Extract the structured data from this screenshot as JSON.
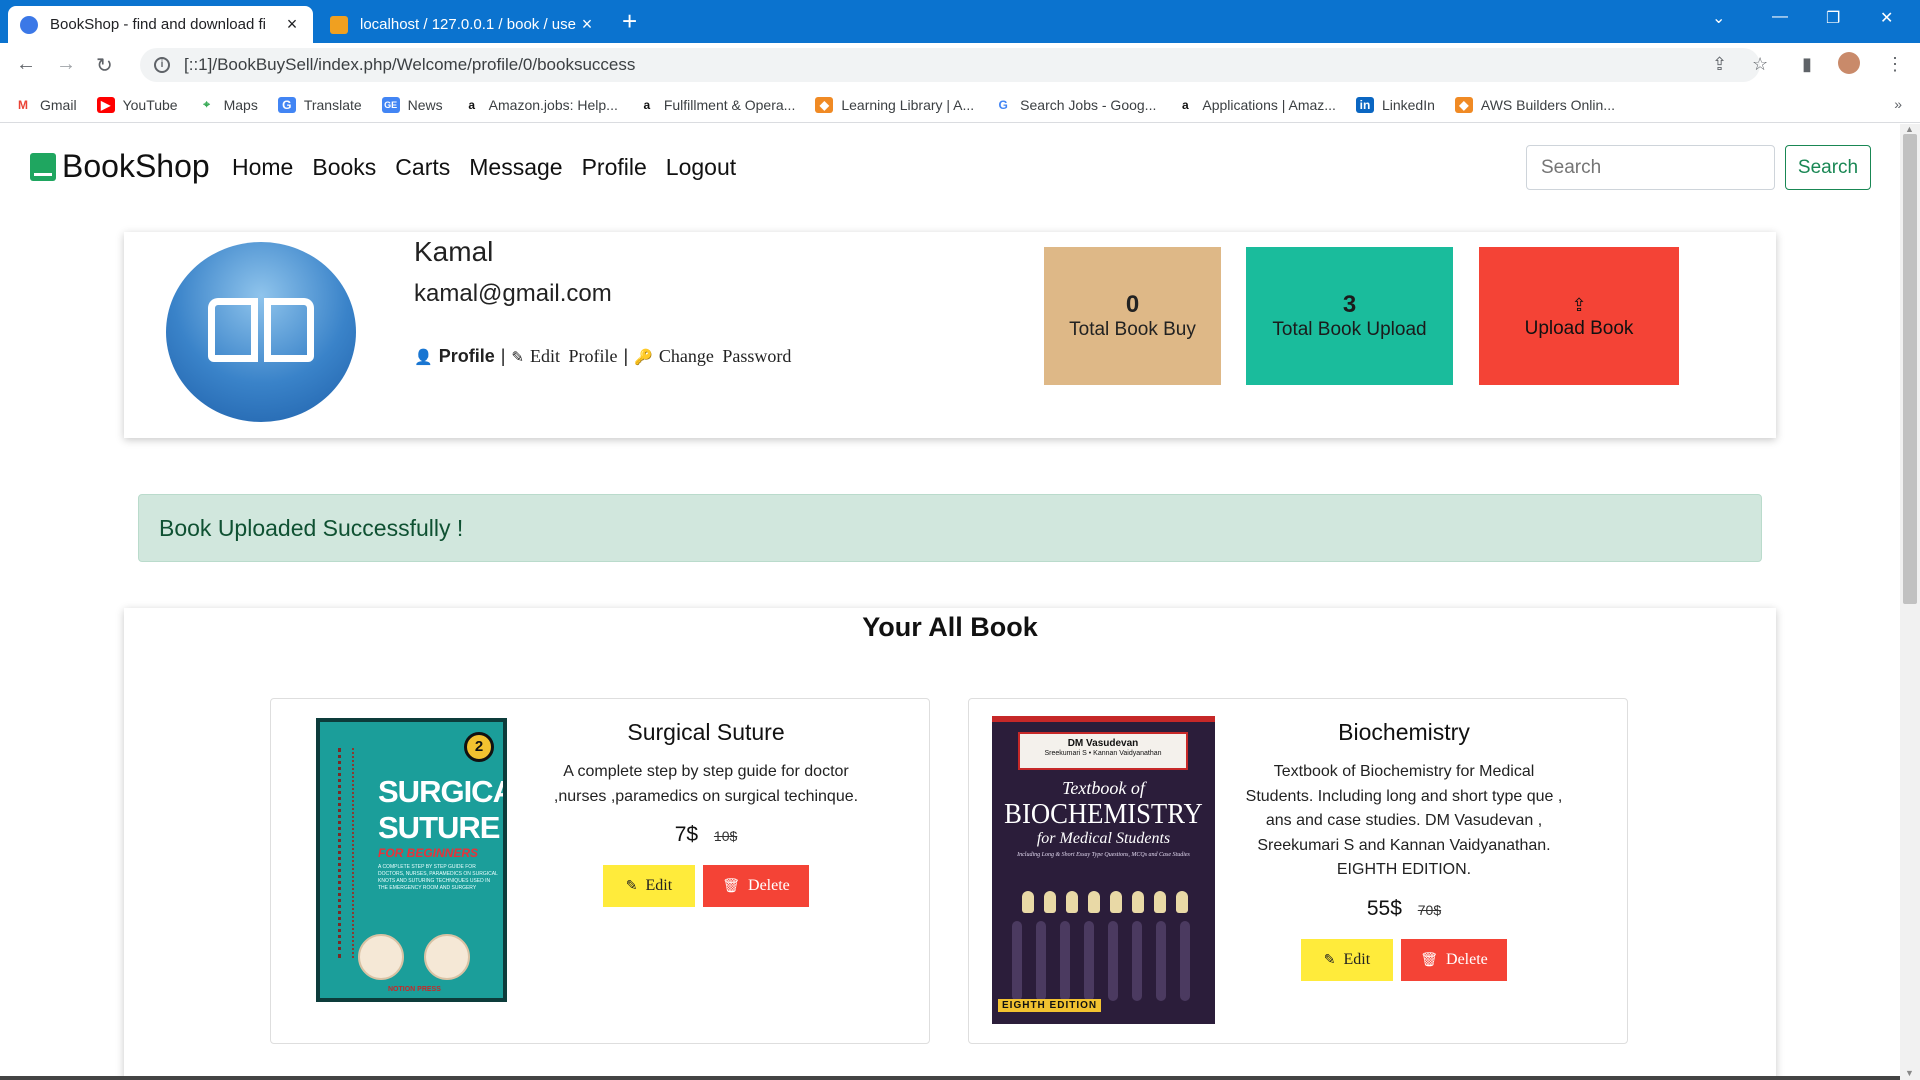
{
  "browser": {
    "tabs": [
      {
        "title": "BookShop - find and download fi",
        "active": true
      },
      {
        "title": "localhost / 127.0.0.1 / book / use",
        "active": false
      }
    ],
    "address": "[::1]/BookBuySell/index.php/Welcome/profile/0/booksuccess",
    "bookmarks": [
      {
        "label": "Gmail",
        "icon": "gmail-icon"
      },
      {
        "label": "YouTube",
        "icon": "youtube-icon"
      },
      {
        "label": "Maps",
        "icon": "maps-icon"
      },
      {
        "label": "Translate",
        "icon": "translate-icon"
      },
      {
        "label": "News",
        "icon": "news-icon"
      },
      {
        "label": "Amazon.jobs: Help...",
        "icon": "amazon-icon"
      },
      {
        "label": "Fulfillment & Opera...",
        "icon": "amazon-icon"
      },
      {
        "label": "Learning Library | A...",
        "icon": "aws-icon"
      },
      {
        "label": "Search Jobs - Goog...",
        "icon": "google-icon"
      },
      {
        "label": "Applications | Amaz...",
        "icon": "amazon-icon"
      },
      {
        "label": "LinkedIn",
        "icon": "linkedin-icon"
      },
      {
        "label": "AWS Builders Onlin...",
        "icon": "aws-icon"
      }
    ]
  },
  "nav": {
    "brand": "BookShop",
    "links": [
      "Home",
      "Books",
      "Carts",
      "Message",
      "Profile",
      "Logout"
    ],
    "search_placeholder": "Search",
    "search_button": "Search"
  },
  "profile": {
    "name": "Kamal",
    "email": "kamal@gmail.com",
    "link_profile": "Profile",
    "link_edit": "Edit Profile",
    "link_password": "Change Password",
    "separator": "|",
    "stats": {
      "buy_count": "0",
      "buy_label": "Total Book Buy",
      "upload_count": "3",
      "upload_label": "Total Book Upload",
      "upload_button": "Upload Book"
    }
  },
  "alert": {
    "message": "Book Uploaded Successfully !"
  },
  "books": {
    "title": "Your All Book",
    "items": [
      {
        "title": "Surgical Suture",
        "description": "A complete step by step guide for doctor ,nurses ,paramedics on surgical techinque.",
        "price": "7$",
        "old_price": "10$",
        "edit": "Edit",
        "delete": "Delete",
        "cover": {
          "line1": "SURGICAL",
          "line2": "SUTURE",
          "subtitle": "FOR BEGINNERS",
          "badge": "2",
          "blurb": "A COMPLETE STEP BY STEP GUIDE FOR DOCTORS, NURSES, PARAMEDICS ON SURGICAL KNOTS AND SUTURING TECHNIQUES USED IN THE EMERGENCY ROOM AND SURGERY",
          "publisher": "NOTION PRESS"
        }
      },
      {
        "title": "Biochemistry",
        "description": "Textbook of Biochemistry for Medical Students. Including long and short type que , ans and case studies. DM Vasudevan , Sreekumari S and Kannan Vaidyanathan. EIGHTH EDITION.",
        "price": "55$",
        "old_price": "70$",
        "edit": "Edit",
        "delete": "Delete",
        "cover": {
          "author": "DM Vasudevan",
          "coauthors": "Sreekumari S • Kannan Vaidyanathan",
          "line1": "Textbook of",
          "line2": "BIOCHEMISTRY",
          "line3": "for Medical Students",
          "line4": "Including Long & Short Essay Type Questions, MCQs and Case Studies",
          "edition": "EIGHTH EDITION"
        }
      }
    ]
  },
  "colors": {
    "stat_buy": "#deb887",
    "stat_upload": "#1abc9c",
    "upload_button": "#f44336",
    "edit_button": "#ffeb3b",
    "delete_button": "#f44336",
    "alert_bg": "#d1e7dd",
    "brand_icon": "#1fa660"
  }
}
